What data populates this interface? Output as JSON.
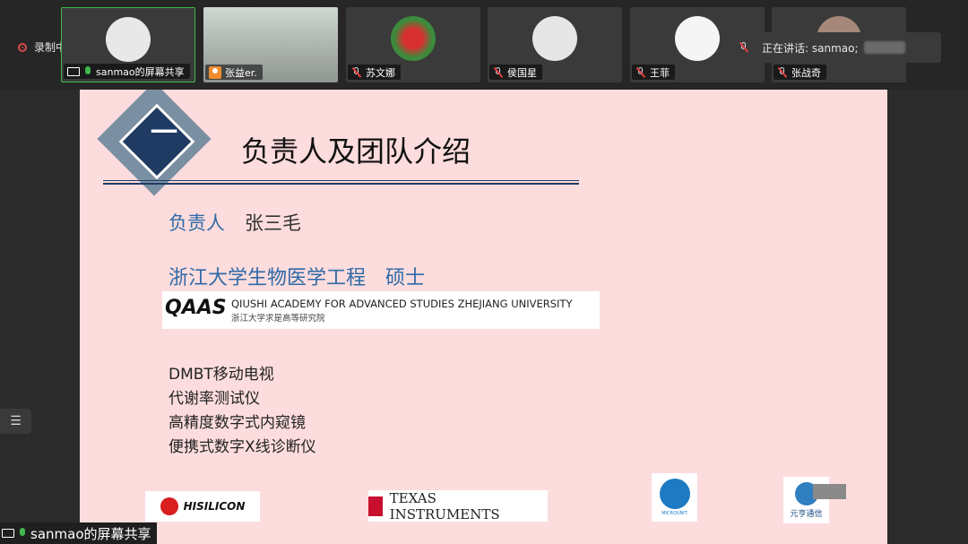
{
  "recording": {
    "label": "录制中"
  },
  "participants": [
    {
      "name": "sanmao的屏幕共享",
      "status": "screen-share",
      "mic": "on",
      "avatar_color": "#e8e8e8"
    },
    {
      "name": "张益er.",
      "status": "camera",
      "mic": "camera",
      "avatar_color": "#6b6f6a"
    },
    {
      "name": "苏文娜",
      "status": "muted",
      "mic": "off",
      "avatar_color": "#3c8a3c"
    },
    {
      "name": "侯国星",
      "status": "muted",
      "mic": "off",
      "avatar_color": "#cccccc"
    },
    {
      "name": "王菲",
      "status": "muted",
      "mic": "off",
      "avatar_color": "#f0f0f0"
    },
    {
      "name": "张战奇",
      "status": "muted",
      "mic": "off",
      "avatar_color": "#a5887a"
    }
  ],
  "speaking": {
    "label": "正在讲话: sanmao;"
  },
  "slide": {
    "title_number": "一",
    "title": "负责人及团队介绍",
    "leader_label": "负责人",
    "leader_name": "张三毛",
    "university": "浙江大学生物医学工程　硕士",
    "qaas": {
      "logo": "QAAS",
      "en": "QIUSHI ACADEMY FOR ADVANCED STUDIES ZHEJIANG UNIVERSITY",
      "cn": "浙江大学求是高等研究院"
    },
    "projects": [
      "DMBT移动电视",
      "代谢率测试仪",
      "高精度数字式内窥镜",
      "便携式数字X线诊断仪"
    ],
    "logos": {
      "hisilicon": "HISILICON",
      "ti": "TEXAS INSTRUMENTS",
      "micro": "MICROUNIT",
      "yuan": "元亨通信"
    }
  },
  "handle_icon": "list-icon",
  "bottom_label": "sanmao的屏幕共享",
  "colors": {
    "accent_blue": "#2e6aa8",
    "slide_bg": "#fcdcdd",
    "navy": "#1f3b63",
    "active_green": "#3fb950"
  }
}
